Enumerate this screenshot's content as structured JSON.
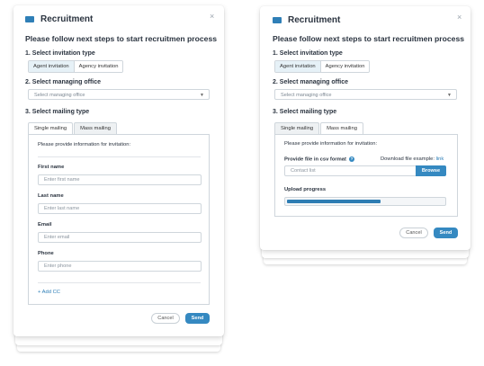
{
  "left": {
    "title": "Recruitment",
    "close": "×",
    "heading": "Please follow next steps to start recruitmen process",
    "step1": "1. Select invitation type",
    "step2": "2. Select managing office",
    "step3": "3. Select mailing type",
    "invitation_options": [
      "Agent invitation",
      "Agency invitation"
    ],
    "office_placeholder": "Select managing office",
    "tabs": [
      "Single mailing",
      "Mass mailing"
    ],
    "intro": "Please provide information for invitation:",
    "fields": [
      {
        "label": "First name",
        "placeholder": "Enter first name"
      },
      {
        "label": "Last name",
        "placeholder": "Enter last name"
      },
      {
        "label": "Email",
        "placeholder": "Enter email"
      },
      {
        "label": "Phone",
        "placeholder": "Enter phone"
      }
    ],
    "add_cc": "+ Add CC",
    "cancel": "Cancel",
    "send": "Send"
  },
  "right": {
    "title": "Recruitment",
    "close": "×",
    "heading": "Please follow next steps to start recruitmen process",
    "step1": "1. Select invitation type",
    "step2": "2. Select managing office",
    "step3": "3. Select mailing type",
    "invitation_options": [
      "Agent invitation",
      "Agency invitation"
    ],
    "office_placeholder": "Select managing office",
    "tabs": [
      "Single mailing",
      "Mass mailing"
    ],
    "intro": "Please provide information for invitation:",
    "csv_label": "Provide file in csv format",
    "help": "?",
    "download_label": "Download file example:",
    "download_link": "link",
    "contact_placeholder": "Contact list",
    "browse": "Browse",
    "upload_label": "Upload progress",
    "upload_progress": 0.6,
    "cancel": "Cancel",
    "send": "Send"
  },
  "colors": {
    "accent": "#3589c1",
    "progress": "#2e7db3",
    "active_tab": "#e6f1f7"
  }
}
